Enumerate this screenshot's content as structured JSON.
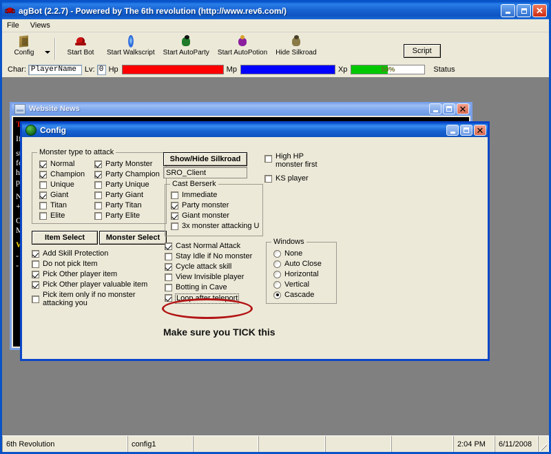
{
  "main_window": {
    "title": "agBot (2.2.7) - Powered by The 6th revolution (http://www.rev6.com/)",
    "icon": "spider-icon",
    "buttons": {
      "minimize": "_",
      "maximize": "□",
      "close": "✕"
    }
  },
  "menu": {
    "items": [
      "File",
      "Views"
    ]
  },
  "toolbar": {
    "items": [
      {
        "label": "Config",
        "icon": "config-icon"
      },
      {
        "label": "Start Bot",
        "icon": "bot-icon"
      },
      {
        "label": "Start Walkscript",
        "icon": "walkscript-icon"
      },
      {
        "label": "Start AutoParty",
        "icon": "autoparty-icon"
      },
      {
        "label": "Start AutoPotion",
        "icon": "autopotion-icon"
      },
      {
        "label": "Hide Silkroad",
        "icon": "silkroad-icon"
      }
    ],
    "dropdown_icon": "chevron-down-icon",
    "script_label": "Script"
  },
  "char_strip": {
    "char_label": "Char:",
    "char_name": "PlayerName",
    "level_label": "Lv:",
    "level_value": "0",
    "hp_label": "Hp",
    "hp_percent": 100,
    "hp_color": "#ff0000",
    "mp_label": "Mp",
    "mp_percent": 100,
    "mp_color": "#0000ff",
    "xp_label": "Xp",
    "xp_percent": 50,
    "xp_text": "50%",
    "xp_color": "#00c800",
    "status_label": "Status"
  },
  "news_window": {
    "title": "Website News",
    "icon": "document-icon",
    "buttons": {
      "minimize": "_",
      "maximize": "□",
      "close": "✕"
    },
    "lines": [
      {
        "text": "Th",
        "color": "red"
      },
      {
        "text": "If",
        "color": "white"
      },
      {
        "text": "st",
        "color": "white"
      },
      {
        "text": "fo",
        "color": "white"
      },
      {
        "text": "ht",
        "color": "white"
      },
      {
        "text": "pa",
        "color": "white"
      },
      {
        "text": "Ne",
        "color": "white"
      },
      {
        "text": "+",
        "color": "white"
      },
      {
        "text": "Ol",
        "color": "white"
      },
      {
        "text": "Mo",
        "color": "white"
      },
      {
        "text": "W",
        "color": "yellow"
      },
      {
        "text": "- ",
        "color": "white"
      },
      {
        "text": "- ",
        "color": "white"
      }
    ]
  },
  "config_window": {
    "title": "Config",
    "icon": "globe-icon",
    "buttons": {
      "minimize": "_",
      "maximize": "□",
      "close": "✕"
    },
    "monster_group": {
      "title": "Monster type to attack",
      "left_column": [
        {
          "label": "Normal",
          "checked": true
        },
        {
          "label": "Champion",
          "checked": true
        },
        {
          "label": "Unique",
          "checked": false
        },
        {
          "label": "Giant",
          "checked": true
        },
        {
          "label": "Titan",
          "checked": false
        },
        {
          "label": "Elite",
          "checked": false
        }
      ],
      "right_column": [
        {
          "label": "Party Monster",
          "checked": true
        },
        {
          "label": "Party Champion",
          "checked": true
        },
        {
          "label": "Party Unique",
          "checked": false
        },
        {
          "label": "Party Giant",
          "checked": false
        },
        {
          "label": "Party Titan",
          "checked": false
        },
        {
          "label": "Party Elite",
          "checked": false
        }
      ]
    },
    "select_buttons": {
      "item": "Item Select",
      "monster": "Monster Select"
    },
    "pick_options": [
      {
        "label": "Add Skill Protection",
        "checked": true,
        "wrap": false
      },
      {
        "label": "Do not pick Item",
        "checked": false,
        "wrap": false
      },
      {
        "label": "Pick Other player item",
        "checked": true,
        "wrap": false
      },
      {
        "label": "Pick Other player valuable item",
        "checked": true,
        "wrap": false
      },
      {
        "label": "Pick item only if no monster attacking you",
        "checked": false,
        "wrap": true
      }
    ],
    "show_hide_button": "Show/Hide Silkroad",
    "client_field_value": "SRO_Client",
    "berserk_group": {
      "title": "Cast Berserk",
      "options": [
        {
          "label": "Immediate",
          "checked": false
        },
        {
          "label": "Party monster",
          "checked": true
        },
        {
          "label": "Giant monster",
          "checked": true
        },
        {
          "label": "3x monster attacking U",
          "checked": false
        }
      ]
    },
    "attack_options": [
      {
        "label": "Cast Normal Attack",
        "checked": true
      },
      {
        "label": "Stay Idle if No monster",
        "checked": false
      },
      {
        "label": "Cycle attack skill",
        "checked": true
      },
      {
        "label": "View Invisible player",
        "checked": false
      },
      {
        "label": "Botting in Cave",
        "checked": false
      },
      {
        "label": "Loop after teleport",
        "checked": true
      }
    ],
    "top_right_options": [
      {
        "label": "High HP\nmonster first",
        "checked": false
      },
      {
        "label": "KS player",
        "checked": false
      }
    ],
    "high_hp_line1": "High HP",
    "high_hp_line2": "monster first",
    "ks_player_label": "KS player",
    "windows_group": {
      "title": "Windows",
      "options": [
        {
          "label": "None",
          "selected": false
        },
        {
          "label": "Auto Close",
          "selected": false
        },
        {
          "label": "Horizontal",
          "selected": false
        },
        {
          "label": "Vertical",
          "selected": false
        },
        {
          "label": "Cascade",
          "selected": true
        }
      ]
    },
    "annotation": {
      "text": "Make sure you TICK this",
      "ellipse_color": "#b31515"
    }
  },
  "statusbar": {
    "cells": [
      "6th Revolution",
      "config1",
      "",
      "",
      "",
      ""
    ],
    "time": "2:04 PM",
    "date": "6/11/2008"
  }
}
